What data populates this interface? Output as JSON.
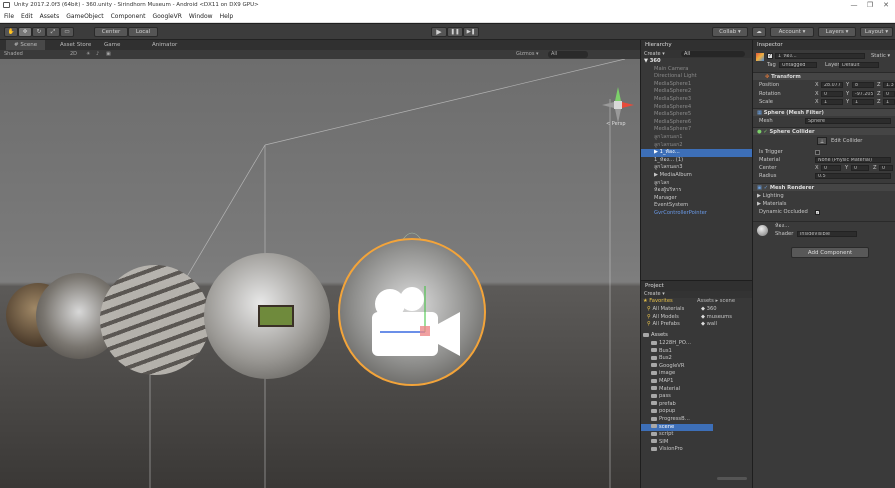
{
  "window": {
    "title": "Unity 2017.2.0f3 (64bit) - 360.unity - Sirindhorn Museum - Android <DX11 on DX9 GPU>",
    "minimize": "—",
    "restore": "❐",
    "close": "✕"
  },
  "menu": [
    "File",
    "Edit",
    "Assets",
    "GameObject",
    "Component",
    "GoogleVR",
    "Window",
    "Help"
  ],
  "toolbar": {
    "pivot": "Center",
    "space": "Local",
    "play": "▶",
    "pause": "❚❚",
    "step": "▶❚",
    "collab": "Collab ▾",
    "account": "Account ▾",
    "layers": "Layers ▾",
    "layout": "Layout ▾"
  },
  "scene_panel": {
    "tabs": [
      "# Scene",
      "Asset Store",
      "Game",
      "Animator"
    ],
    "shading": "Shaded",
    "mode_2d": "2D",
    "gizmos": "Gizmos ▾",
    "search": "All",
    "persp_label": "< Persp"
  },
  "hierarchy": {
    "tab": "Hierarchy",
    "create": "Create ▾",
    "search": "All",
    "items": [
      {
        "label": "▼ 360",
        "indent": 0,
        "style": "root"
      },
      {
        "label": "Main Camera",
        "indent": 1,
        "style": "dim"
      },
      {
        "label": "Directional Light",
        "indent": 1,
        "style": "dim"
      },
      {
        "label": "MediaSphere1",
        "indent": 1,
        "style": "dim"
      },
      {
        "label": "MediaSphere2",
        "indent": 1,
        "style": "dim"
      },
      {
        "label": "MediaSphere3",
        "indent": 1,
        "style": "dim"
      },
      {
        "label": "MediaSphere4",
        "indent": 1,
        "style": "dim"
      },
      {
        "label": "MediaSphere5",
        "indent": 1,
        "style": "dim"
      },
      {
        "label": "MediaSphere6",
        "indent": 1,
        "style": "dim"
      },
      {
        "label": "MediaSphere7",
        "indent": 1,
        "style": "dim"
      },
      {
        "label": "ลูกโลกนอก1",
        "indent": 1,
        "style": "dim"
      },
      {
        "label": "ลูกโลกนอก2",
        "indent": 1,
        "style": "dim"
      },
      {
        "label": "▶ 1_ห้อง…",
        "indent": 1,
        "style": "selected"
      },
      {
        "label": "1_ห้อง… (1)",
        "indent": 1,
        "style": "normal"
      },
      {
        "label": "ลูกโลกนอก3",
        "indent": 1,
        "style": "normal"
      },
      {
        "label": "▶ MediaAlbum",
        "indent": 1,
        "style": "normal"
      },
      {
        "label": "ลูกโลก",
        "indent": 1,
        "style": "normal"
      },
      {
        "label": "ห้องผู้บริหาร",
        "indent": 1,
        "style": "normal"
      },
      {
        "label": "Manager",
        "indent": 1,
        "style": "normal"
      },
      {
        "label": "EventSystem",
        "indent": 1,
        "style": "normal"
      },
      {
        "label": "GvrControllerPointer",
        "indent": 1,
        "style": "prefab"
      }
    ]
  },
  "project": {
    "tab": "Project",
    "create": "Create ▾",
    "favorites_title": "★ Favorites",
    "favorites": [
      "All Materials",
      "All Models",
      "All Prefabs"
    ],
    "breadcrumb": "Assets ▸ scene",
    "files": [
      "360",
      "museums",
      "wall"
    ],
    "assets_title": "Assets",
    "folders": [
      "1228H_PO…",
      "Bus1",
      "Bus2",
      "GoogleVR",
      "image",
      "MAP1",
      "Material",
      "pass",
      "prefab",
      "popup",
      "ProgressB…",
      "scene",
      "script",
      "SIM",
      "VisionPro"
    ],
    "selected_folder": "scene"
  },
  "inspector": {
    "tab": "Inspector",
    "object_name": "1_ห้อง…",
    "static": "Static ▾",
    "tag_label": "Tag",
    "tag_value": "Untagged",
    "layer_label": "Layer",
    "layer_value": "Default",
    "transform": {
      "title": "Transform",
      "rows": [
        {
          "label": "Position",
          "x": "28.077",
          "y": "8",
          "z": "1.34"
        },
        {
          "label": "Rotation",
          "x": "0",
          "y": "-97.205",
          "z": "0"
        },
        {
          "label": "Scale",
          "x": "1",
          "y": "1",
          "z": "1"
        }
      ]
    },
    "mesh_filter": {
      "title": "Sphere (Mesh Filter)",
      "mesh_label": "Mesh",
      "mesh_value": "Sphere"
    },
    "sphere_collider": {
      "title": "Sphere Collider",
      "edit": "Edit Collider",
      "is_trigger": "Is Trigger",
      "material_label": "Material",
      "material_value": "None (Physic Material)",
      "center_label": "Center",
      "cx": "0",
      "cy": "0",
      "cz": "0",
      "radius_label": "Radius",
      "radius": "0.5"
    },
    "mesh_renderer": {
      "title": "Mesh Renderer",
      "lighting": "▶ Lighting",
      "materials": "▶ Materials",
      "dynamic_occluded": "Dynamic Occluded"
    },
    "material": {
      "name": "ห้อง…",
      "shader_label": "Shader",
      "shader_value": "InsideVisible"
    },
    "add_component": "Add Component"
  },
  "colors": {
    "selection_orange": "#f3a43a",
    "panel_bg": "#383838",
    "accent_blue": "#4b7bd6"
  }
}
